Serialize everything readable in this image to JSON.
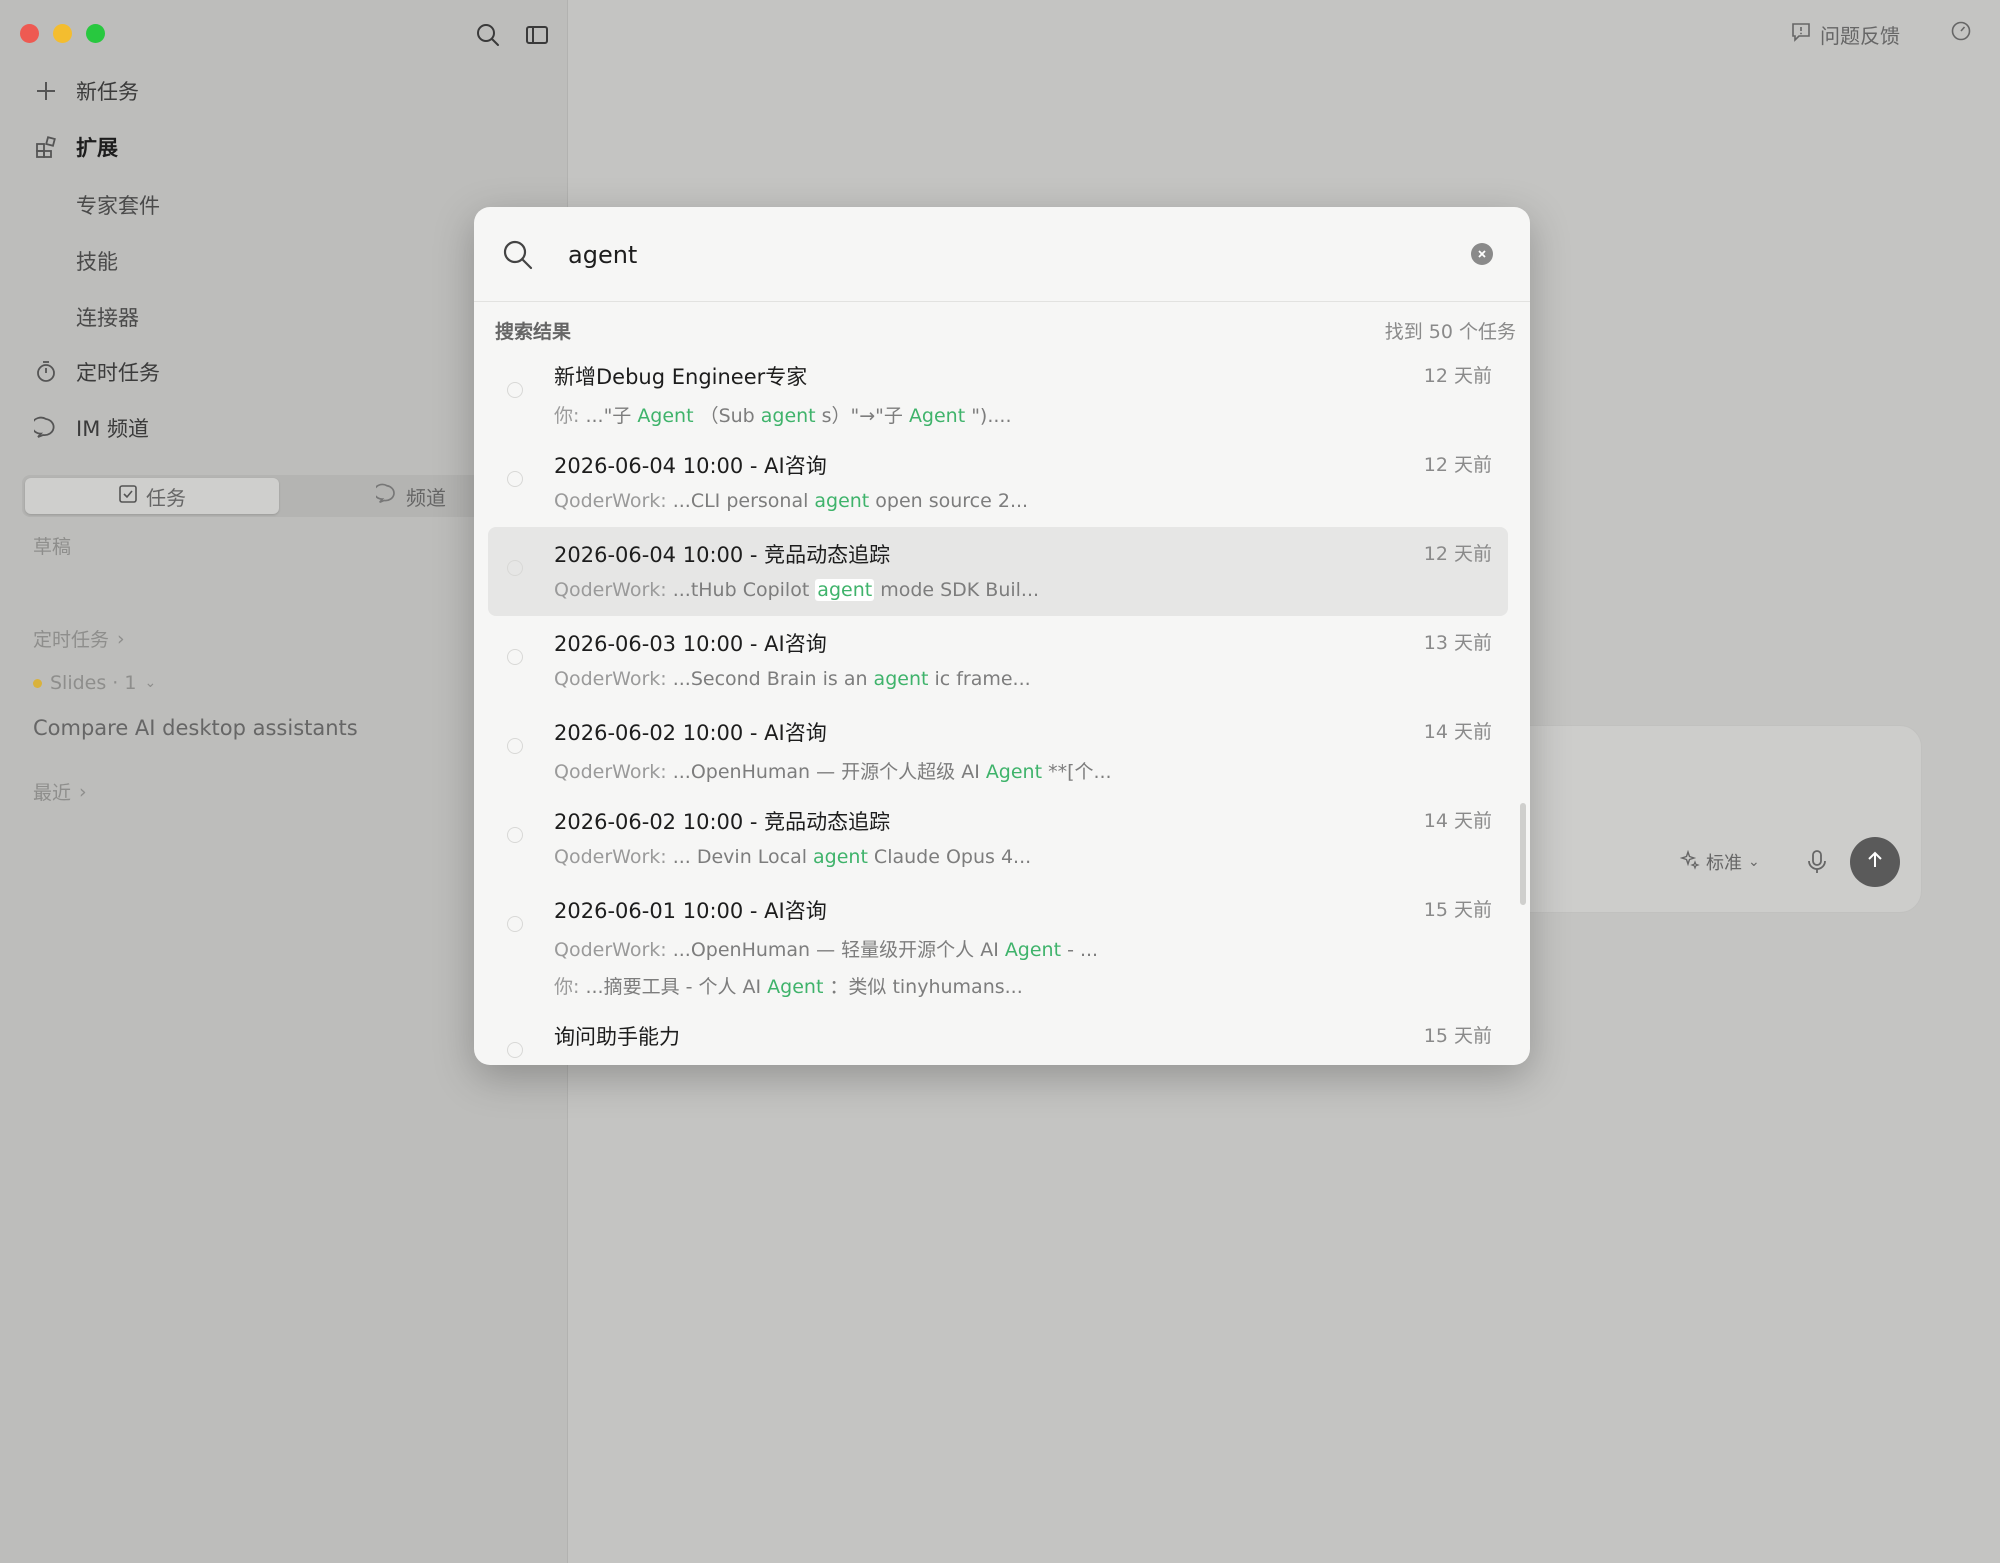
{
  "sidebar": {
    "new_task": "新任务",
    "extensions": "扩展",
    "sub_items": [
      "专家套件",
      "技能",
      "连接器"
    ],
    "scheduled_tasks": "定时任务",
    "im_channels": "IM 频道",
    "segment": {
      "tasks": "任务",
      "channels": "频道"
    },
    "drafts": "草稿",
    "scheduled_section": "定时任务",
    "slides_label": "Slides · 1",
    "task_entry": "Compare AI desktop assistants",
    "recent_section": "最近"
  },
  "topbar": {
    "feedback": "问题反馈"
  },
  "composer": {
    "mode": "标准"
  },
  "search": {
    "query": "agent",
    "results_heading": "搜索结果",
    "results_count": "找到 50 个任务",
    "results": [
      {
        "title": "新增Debug Engineer专家",
        "time": "12 天前",
        "lines": [
          {
            "prefix": "你: ",
            "parts": [
              {
                "t": "...\"子"
              },
              {
                "t": "Agent",
                "h": true
              },
              {
                "t": "（Sub"
              },
              {
                "t": "agent",
                "h": true
              },
              {
                "t": "s）\"→\"子"
              },
              {
                "t": "Agent",
                "h": true
              },
              {
                "t": "\")...."
              }
            ]
          }
        ]
      },
      {
        "title": "2026-06-04 10:00 - AI咨询",
        "time": "12 天前",
        "lines": [
          {
            "prefix": "QoderWork: ",
            "parts": [
              {
                "t": "...CLI personal"
              },
              {
                "t": "agent",
                "h": true
              },
              {
                "t": "open source 2..."
              }
            ]
          }
        ]
      },
      {
        "title": "2026-06-04 10:00 - 竞品动态追踪",
        "time": "12 天前",
        "selected": true,
        "lines": [
          {
            "prefix": "QoderWork: ",
            "parts": [
              {
                "t": "...tHub Copilot"
              },
              {
                "t": "agent",
                "h": true,
                "box": true
              },
              {
                "t": "mode SDK Buil..."
              }
            ]
          }
        ]
      },
      {
        "title": "2026-06-03 10:00 - AI咨询",
        "time": "13 天前",
        "lines": [
          {
            "prefix": "QoderWork: ",
            "parts": [
              {
                "t": "...Second Brain is an"
              },
              {
                "t": "agent",
                "h": true
              },
              {
                "t": "ic frame..."
              }
            ]
          }
        ]
      },
      {
        "title": "2026-06-02 10:00 - AI咨询",
        "time": "14 天前",
        "lines": [
          {
            "prefix": "QoderWork: ",
            "parts": [
              {
                "t": "...OpenHuman — 开源个人超级 AI"
              },
              {
                "t": "Agent",
                "h": true
              },
              {
                "t": "**[个..."
              }
            ]
          }
        ]
      },
      {
        "title": "2026-06-02 10:00 - 竞品动态追踪",
        "time": "14 天前",
        "lines": [
          {
            "prefix": "QoderWork: ",
            "parts": [
              {
                "t": "... Devin Local"
              },
              {
                "t": "agent",
                "h": true
              },
              {
                "t": "Claude Opus 4..."
              }
            ]
          }
        ]
      },
      {
        "title": "2026-06-01 10:00 - AI咨询",
        "time": "15 天前",
        "lines": [
          {
            "prefix": "QoderWork: ",
            "parts": [
              {
                "t": "...OpenHuman — 轻量级开源个人 AI"
              },
              {
                "t": "Agent",
                "h": true
              },
              {
                "t": "- ..."
              }
            ]
          },
          {
            "prefix": "你: ",
            "parts": [
              {
                "t": "...摘要工具 - 个人 AI"
              },
              {
                "t": "Agent",
                "h": true
              },
              {
                "t": "：类似 tinyhumans..."
              }
            ]
          }
        ]
      },
      {
        "title": "询问助手能力",
        "time": "15 天前",
        "lines": []
      }
    ]
  }
}
